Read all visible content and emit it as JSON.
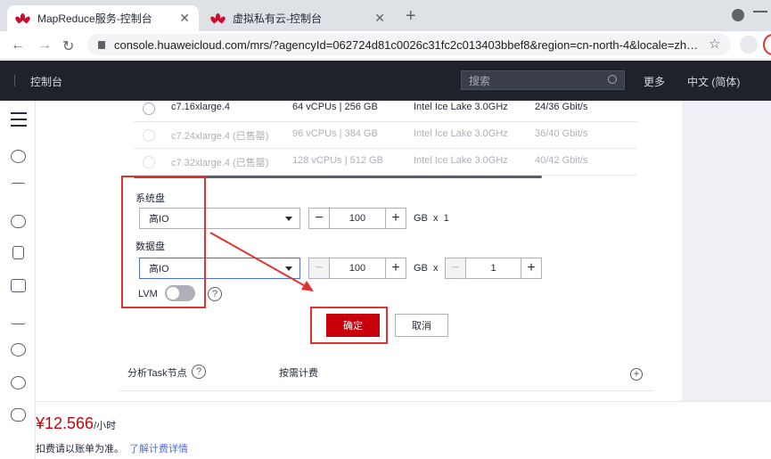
{
  "browser": {
    "tabs": [
      {
        "title": "MapReduce服务-控制台",
        "active": true
      },
      {
        "title": "虚拟私有云-控制台",
        "active": false
      }
    ],
    "url": "console.huaweicloud.com/mrs/?agencyId=062724d81c0026c31fc2c013403bbef8&region=cn-north-4&locale=zh…"
  },
  "header": {
    "console_label": "控制台",
    "search_placeholder": "搜索",
    "more_label": "更多",
    "language_label": "中文 (简体)"
  },
  "flavors": [
    {
      "name": "c7.16xlarge.4",
      "spec": "64 vCPUs | 256 GB",
      "cpu": "Intel Ice Lake 3.0GHz",
      "bandwidth": "24/36 Gbit/s",
      "disabled": false
    },
    {
      "name": "c7.24xlarge.4 (已售罄)",
      "spec": "96 vCPUs | 384 GB",
      "cpu": "Intel Ice Lake 3.0GHz",
      "bandwidth": "36/40 Gbit/s",
      "disabled": true
    },
    {
      "name": "c7.32xlarge.4 (已售罄)",
      "spec": "128 vCPUs | 512 GB",
      "cpu": "Intel Ice Lake 3.0GHz",
      "bandwidth": "40/42 Gbit/s",
      "disabled": true
    }
  ],
  "form": {
    "system_disk": {
      "label": "系统盘",
      "type": "高IO",
      "size": "100",
      "unit": "GB",
      "times": "x",
      "count": "1"
    },
    "data_disk": {
      "label": "数据盘",
      "type": "高IO",
      "size": "100",
      "unit": "GB",
      "times": "x",
      "count": "1"
    },
    "lvm_label": "LVM",
    "lvm_enabled": false,
    "help_glyph": "?",
    "confirm_label": "确定",
    "cancel_label": "取消"
  },
  "section": {
    "node_group_label": "分析Task节点",
    "billing_label": "按需计费"
  },
  "footer": {
    "price": "¥12.566",
    "price_unit": "/小时",
    "note": "扣费请以账单为准。",
    "link": "了解计费详情"
  },
  "colors": {
    "accent_red": "#c7000b",
    "annotation_red": "#e0322e",
    "header_bg": "#1f222b",
    "link_blue": "#526ecc"
  }
}
